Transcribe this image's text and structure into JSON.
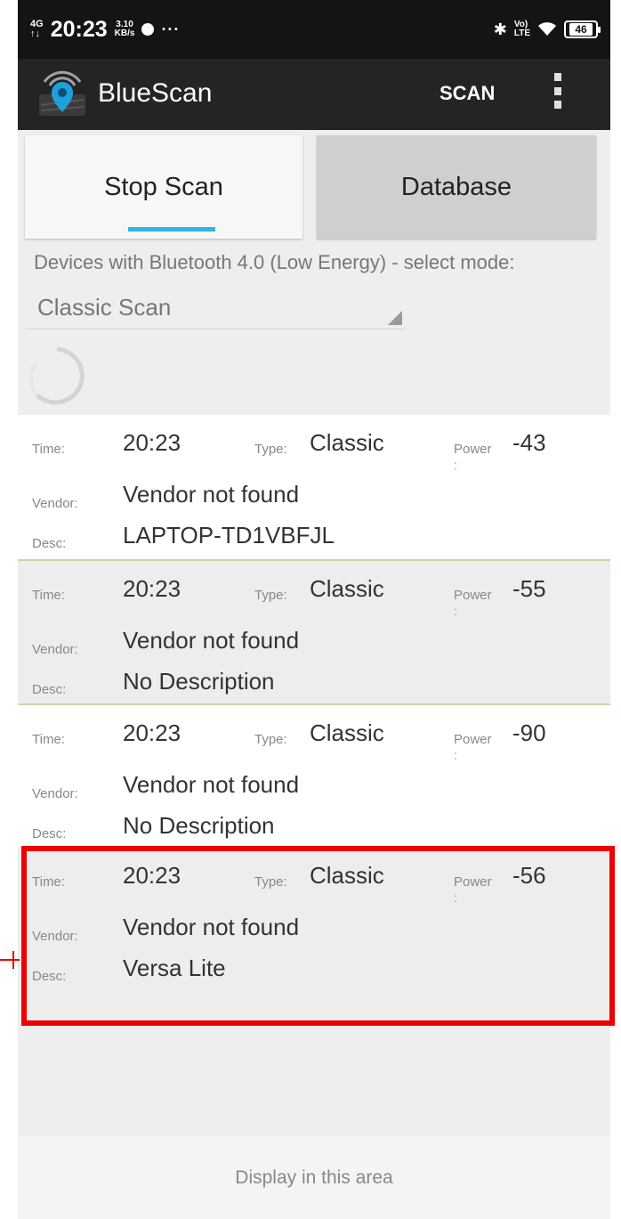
{
  "status_bar": {
    "network_top": "4G",
    "network_bottom": "↑↓",
    "time": "20:23",
    "speed_value": "3.10",
    "speed_unit": "KB/s",
    "more": "···",
    "volte_top": "Vo)",
    "volte_bottom": "LTE",
    "battery": "46",
    "icons": [
      "signal-icon",
      "chat-icon",
      "bluetooth-icon",
      "wifi-icon",
      "battery-icon"
    ]
  },
  "action_bar": {
    "title": "BlueScan",
    "scan_label": "SCAN",
    "icons": [
      "app-logo-icon",
      "overflow-menu-icon"
    ]
  },
  "tabs": [
    {
      "label": "Stop Scan",
      "selected": true
    },
    {
      "label": "Database",
      "selected": false
    }
  ],
  "mode": {
    "label": "Devices with Bluetooth 4.0 (Low Energy) - select mode:",
    "selected": "Classic Scan"
  },
  "field_labels": {
    "time": "Time:",
    "type": "Type:",
    "power": "Power",
    "power_colon": ":",
    "vendor": "Vendor:",
    "desc": "Desc:"
  },
  "devices": [
    {
      "time": "20:23",
      "type": "Classic",
      "power": "-43",
      "vendor": "Vendor not found",
      "desc": "LAPTOP-TD1VBFJL"
    },
    {
      "time": "20:23",
      "type": "Classic",
      "power": "-55",
      "vendor": "Vendor not found",
      "desc": "No Description"
    },
    {
      "time": "20:23",
      "type": "Classic",
      "power": "-90",
      "vendor": "Vendor not found",
      "desc": "No Description"
    },
    {
      "time": "20:23",
      "type": "Classic",
      "power": "-56",
      "vendor": "Vendor not found",
      "desc": "Versa Lite"
    }
  ],
  "ad_area": "Display in this area",
  "colors": {
    "status_bar": "#141414",
    "action_bar": "#242424",
    "tab_indicator": "#33b5e5",
    "highlight": "#ef0000"
  }
}
